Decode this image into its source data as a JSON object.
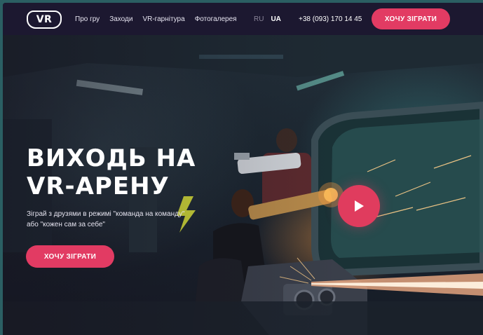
{
  "header": {
    "logo_text": "VR",
    "nav": [
      "Про гру",
      "Заходи",
      "VR-гарнітура",
      "Фотогалерея"
    ],
    "lang": {
      "ru": "RU",
      "ua": "UA",
      "active": "UA"
    },
    "phone": "+38 (093) 170 14 45",
    "cta_label": "ХОЧУ ЗІГРАТИ"
  },
  "hero": {
    "title_line1": "ВИХОДЬ НА",
    "title_line2": "VR-АРЕНУ",
    "subtitle": "Зіграй з друзями в режимі \"команда на команду\" або \"кожен сам за себе\"",
    "cta_label": "ХОЧУ ЗІГРАТИ",
    "play_icon": "play-icon"
  },
  "colors": {
    "accent": "#e23b63",
    "header_bg": "#1c1830",
    "page_bg": "#16131f"
  }
}
